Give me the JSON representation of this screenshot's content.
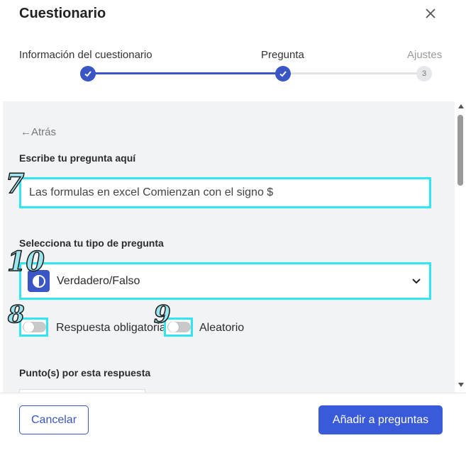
{
  "modal": {
    "title": "Cuestionario",
    "close_icon": "close-icon"
  },
  "stepper": {
    "steps": [
      {
        "label": "Información del cuestionario",
        "status": "completed"
      },
      {
        "label": "Pregunta",
        "status": "completed"
      },
      {
        "label": "Ajustes",
        "status": "pending",
        "number": "3"
      }
    ]
  },
  "form": {
    "back_label": "←Atrás",
    "question_label": "Escribe tu pregunta aquí",
    "question_value": "Las formulas en excel Comienzan con el signo $",
    "type_label": "Selecciona tu tipo de pregunta",
    "type_value": "Verdadero/Falso",
    "type_icon": "half-circle-icon",
    "required_toggle": {
      "label": "Respuesta obligatoria",
      "on": false
    },
    "random_toggle": {
      "label": "Aleatorio",
      "on": false
    },
    "points_label": "Punto(s) por esta respuesta"
  },
  "annotations": {
    "question_input": "7",
    "type_select": "10",
    "required_toggle": "8",
    "random_toggle": "9"
  },
  "footer": {
    "cancel_label": "Cancelar",
    "add_label": "Añadir a preguntas"
  },
  "colors": {
    "accent": "#3a56c5",
    "highlight": "#31e6ef",
    "panel_bg": "#f2f3f5"
  }
}
